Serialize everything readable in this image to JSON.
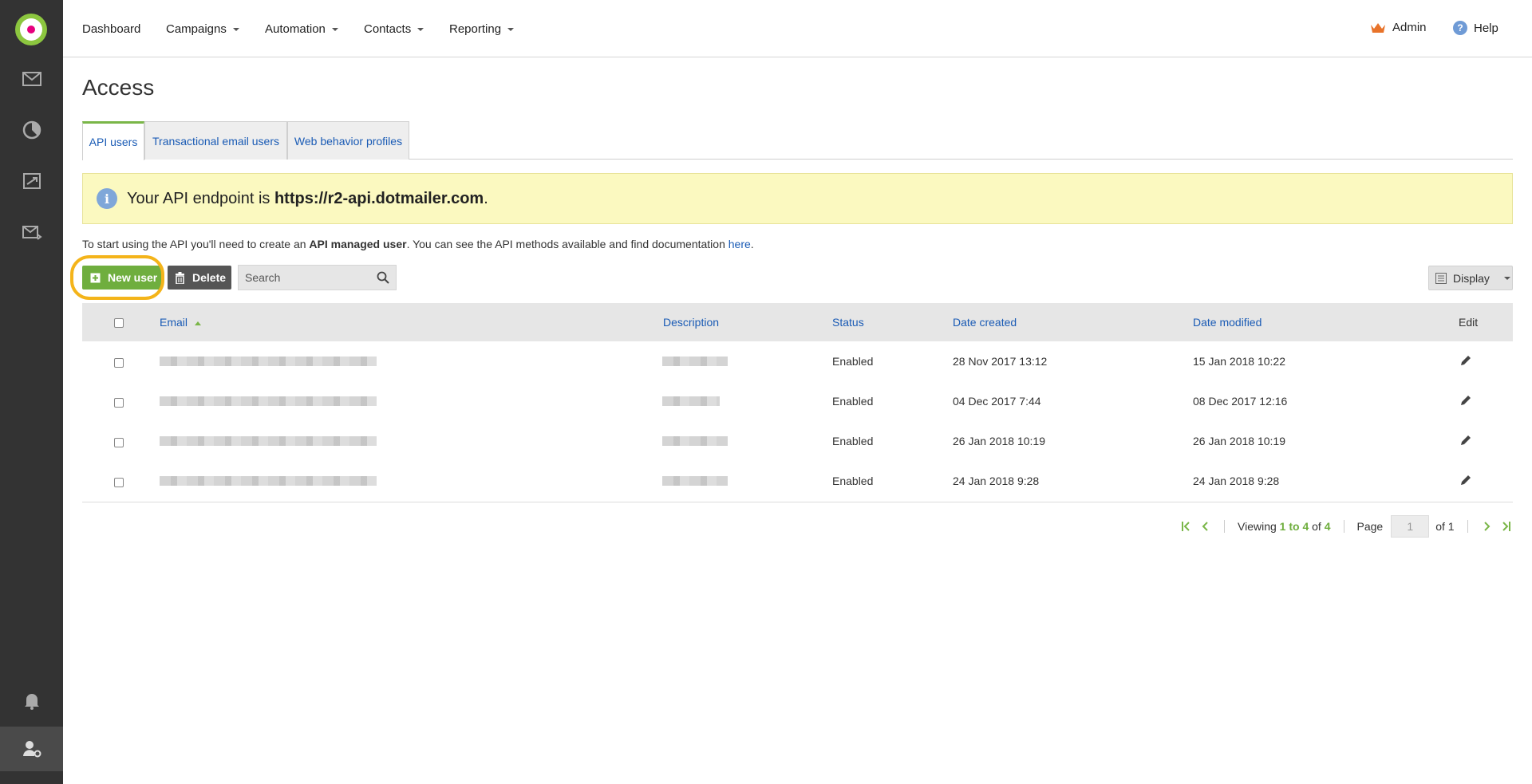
{
  "sidebar": {
    "items": [
      {
        "name": "email-icon"
      },
      {
        "name": "reports-pie-icon"
      },
      {
        "name": "automation-icon"
      },
      {
        "name": "transactional-email-icon"
      },
      {
        "name": "notifications-bell-icon"
      },
      {
        "name": "user-settings-icon"
      }
    ]
  },
  "nav": {
    "dashboard": "Dashboard",
    "campaigns": "Campaigns",
    "automation": "Automation",
    "contacts": "Contacts",
    "reporting": "Reporting",
    "admin": "Admin",
    "help": "Help"
  },
  "page": {
    "title": "Access"
  },
  "tabs": [
    {
      "label": "API users",
      "active": true
    },
    {
      "label": "Transactional email users",
      "active": false
    },
    {
      "label": "Web behavior profiles",
      "active": false
    }
  ],
  "alert": {
    "prefix": "Your API endpoint is ",
    "endpoint": "https://r2-api.dotmailer.com",
    "suffix": "."
  },
  "intro": {
    "part1": "To start using the API you'll need to create an ",
    "bold": "API managed user",
    "part2": ". You can see the API methods available and find documentation ",
    "link": "here",
    "end": "."
  },
  "toolbar": {
    "new_user": "New user",
    "delete": "Delete",
    "search_placeholder": "Search",
    "display": "Display"
  },
  "table": {
    "headers": {
      "email": "Email",
      "description": "Description",
      "status": "Status",
      "date_created": "Date created",
      "date_modified": "Date modified",
      "edit": "Edit"
    },
    "rows": [
      {
        "status": "Enabled",
        "created": "28 Nov 2017 13:12",
        "modified": "15 Jan 2018 10:22"
      },
      {
        "status": "Enabled",
        "created": "04 Dec 2017 7:44",
        "modified": "08 Dec 2017 12:16"
      },
      {
        "status": "Enabled",
        "created": "26 Jan 2018 10:19",
        "modified": "26 Jan 2018 10:19"
      },
      {
        "status": "Enabled",
        "created": "24 Jan 2018 9:28",
        "modified": "24 Jan 2018 9:28"
      }
    ]
  },
  "pager": {
    "viewing": "Viewing",
    "range": "1 to 4",
    "of": "of",
    "total": "4",
    "page_label": "Page",
    "page_value": "1",
    "of_pages": "of 1"
  },
  "colors": {
    "sidebar": "#333333",
    "accent_green": "#6fae3e",
    "link_blue": "#1a5bb5",
    "alert_bg": "#fbf9c0",
    "highlight": "#f4b41a"
  }
}
